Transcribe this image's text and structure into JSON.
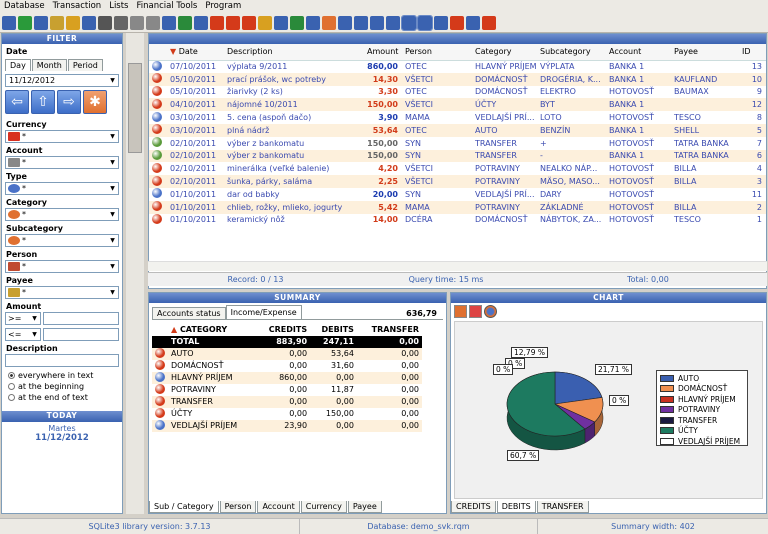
{
  "menu": [
    "Database",
    "Transaction",
    "Lists",
    "Financial Tools",
    "Program"
  ],
  "toolbar_icons": [
    "db-icon",
    "refresh-icon",
    "db2-icon",
    "lock-icon",
    "folder-icon",
    "save-icon",
    "eye-icon",
    "comments-icon",
    "calc-icon",
    "grid-icon",
    "doc-icon",
    "excel-icon",
    "xml-icon",
    "graph-icon",
    "gem-icon",
    "cart-icon",
    "pencil-icon",
    "users-icon",
    "tree-icon",
    "bank-icon",
    "tag-icon",
    "table-icon",
    "cal-icon",
    "list-icon",
    "screen-icon",
    "view1-icon",
    "view2-icon",
    "help-icon",
    "globe-icon",
    "info-icon",
    "power-icon"
  ],
  "filter": {
    "title": "FILTER",
    "date_label": "Date",
    "tabs": [
      "Day",
      "Month",
      "Period"
    ],
    "date_value": "11/12/2012",
    "currency_label": "Currency",
    "currency_value": "*",
    "account_label": "Account",
    "account_value": "*",
    "type_label": "Type",
    "type_value": "*",
    "category_label": "Category",
    "category_value": "*",
    "subcategory_label": "Subcategory",
    "subcategory_value": "*",
    "person_label": "Person",
    "person_value": "*",
    "payee_label": "Payee",
    "payee_value": "*",
    "amount_label": "Amount",
    "amount_op1": ">=",
    "amount_op2": "<=",
    "description_label": "Description",
    "radios": [
      "everywhere in text",
      "at the beginning",
      "at the end of text"
    ],
    "today_title": "TODAY",
    "today_day": "Martes",
    "today_date": "11/12/2012"
  },
  "grid": {
    "headers": [
      "Date",
      "Description",
      "Amount",
      "Person",
      "Category",
      "Subcategory",
      "Account",
      "Payee",
      "ID"
    ],
    "rows": [
      {
        "icon": "#4a72c8",
        "date": "07/10/2011",
        "desc": "výplata 9/2011",
        "amount": "860,00",
        "color": "blue",
        "person": "OTEC",
        "cat": "HLAVNÝ PRÍJEM",
        "sub": "VÝPLATA",
        "acc": "BANKA 1",
        "payee": "",
        "id": "13"
      },
      {
        "icon": "#d43a1a",
        "date": "05/10/2011",
        "desc": "prací prášok, wc potreby",
        "amount": "14,30",
        "color": "red",
        "person": "VŠETCI",
        "cat": "DOMÁCNOSŤ",
        "sub": "DROGÉRIA, K...",
        "acc": "BANKA 1",
        "payee": "KAUFLAND",
        "id": "10"
      },
      {
        "icon": "#d43a1a",
        "date": "05/10/2011",
        "desc": "žiarivky (2 ks)",
        "amount": "3,30",
        "color": "red",
        "person": "OTEC",
        "cat": "DOMÁCNOSŤ",
        "sub": "ELEKTRO",
        "acc": "HOTOVOSŤ",
        "payee": "BAUMAX",
        "id": "9"
      },
      {
        "icon": "#d43a1a",
        "date": "04/10/2011",
        "desc": "nájomné 10/2011",
        "amount": "150,00",
        "color": "red",
        "person": "VŠETCI",
        "cat": "ÚČTY",
        "sub": "BYT",
        "acc": "BANKA 1",
        "payee": "",
        "id": "12"
      },
      {
        "icon": "#4a72c8",
        "date": "03/10/2011",
        "desc": "5. cena (aspoň dačo)",
        "amount": "3,90",
        "color": "blue",
        "person": "MAMA",
        "cat": "VEDLAJŠÍ PRÍ...",
        "sub": "LOTO",
        "acc": "HOTOVOSŤ",
        "payee": "TESCO",
        "id": "8"
      },
      {
        "icon": "#d43a1a",
        "date": "03/10/2011",
        "desc": "plná nádrž",
        "amount": "53,64",
        "color": "red",
        "person": "OTEC",
        "cat": "AUTO",
        "sub": "BENZÍN",
        "acc": "BANKA 1",
        "payee": "SHELL",
        "id": "5"
      },
      {
        "icon": "#5a9a3a",
        "date": "02/10/2011",
        "desc": "výber z bankomatu",
        "amount": "150,00",
        "color": "gray",
        "person": "SYN",
        "cat": "TRANSFER",
        "sub": "+",
        "acc": "HOTOVOSŤ",
        "payee": "TATRA BANKA",
        "id": "7"
      },
      {
        "icon": "#5a9a3a",
        "date": "02/10/2011",
        "desc": "výber z bankomatu",
        "amount": "150,00",
        "color": "gray",
        "person": "SYN",
        "cat": "TRANSFER",
        "sub": "-",
        "acc": "BANKA 1",
        "payee": "TATRA BANKA",
        "id": "6"
      },
      {
        "icon": "#d43a1a",
        "date": "02/10/2011",
        "desc": "minerálka (veľké balenie)",
        "amount": "4,20",
        "color": "red",
        "person": "VŠETCI",
        "cat": "POTRAVINY",
        "sub": "NEALKO NÁP...",
        "acc": "HOTOVOSŤ",
        "payee": "BILLA",
        "id": "4"
      },
      {
        "icon": "#d43a1a",
        "date": "02/10/2011",
        "desc": "šunka, párky, saláma",
        "amount": "2,25",
        "color": "red",
        "person": "VŠETCI",
        "cat": "POTRAVINY",
        "sub": "MÄSO, MASO...",
        "acc": "HOTOVOSŤ",
        "payee": "BILLA",
        "id": "3"
      },
      {
        "icon": "#4a72c8",
        "date": "01/10/2011",
        "desc": "dar od babky",
        "amount": "20,00",
        "color": "blue",
        "person": "SYN",
        "cat": "VEDLAJŠÍ PRÍ...",
        "sub": "DARY",
        "acc": "HOTOVOSŤ",
        "payee": "",
        "id": "11"
      },
      {
        "icon": "#d43a1a",
        "date": "01/10/2011",
        "desc": "chlieb, rožky, mlieko, jogurty",
        "amount": "5,42",
        "color": "red",
        "person": "MAMA",
        "cat": "POTRAVINY",
        "sub": "ZÁKLADNÉ",
        "acc": "HOTOVOSŤ",
        "payee": "BILLA",
        "id": "2"
      },
      {
        "icon": "#d43a1a",
        "date": "01/10/2011",
        "desc": "keramický nôž",
        "amount": "14,00",
        "color": "red",
        "person": "DCÉRA",
        "cat": "DOMÁCNOSŤ",
        "sub": "NÁBYTOK, ZA...",
        "acc": "HOTOVOSŤ",
        "payee": "TESCO",
        "id": "1"
      }
    ],
    "status_record": "Record: 0 / 13",
    "status_query": "Query time: 15 ms",
    "status_total": "Total: 0,00"
  },
  "summary": {
    "title": "SUMMARY",
    "tabs": [
      "Accounts status",
      "Income/Expense"
    ],
    "value": "636,79",
    "headers": [
      "CATEGORY",
      "CREDITS",
      "DEBITS",
      "TRANSFER"
    ],
    "total": {
      "cat": "TOTAL",
      "credits": "883,90",
      "debits": "247,11",
      "transfer": "0,00"
    },
    "rows": [
      {
        "cat": "AUTO",
        "credits": "0,00",
        "debits": "53,64",
        "transfer": "0,00"
      },
      {
        "cat": "DOMÁCNOSŤ",
        "credits": "0,00",
        "debits": "31,60",
        "transfer": "0,00"
      },
      {
        "cat": "HLAVNÝ PRÍJEM",
        "credits": "860,00",
        "debits": "0,00",
        "transfer": "0,00"
      },
      {
        "cat": "POTRAVINY",
        "credits": "0,00",
        "debits": "11,87",
        "transfer": "0,00"
      },
      {
        "cat": "TRANSFER",
        "credits": "0,00",
        "debits": "0,00",
        "transfer": "0,00"
      },
      {
        "cat": "ÚČTY",
        "credits": "0,00",
        "debits": "150,00",
        "transfer": "0,00"
      },
      {
        "cat": "VEDLAJŠÍ PRÍJEM",
        "credits": "23,90",
        "debits": "0,00",
        "transfer": "0,00"
      }
    ],
    "bottom_tabs": [
      "Sub / Category",
      "Person",
      "Account",
      "Currency",
      "Payee"
    ]
  },
  "chart": {
    "title": "CHART",
    "bottom_tabs": [
      "CREDITS",
      "DEBITS",
      "TRANSFER"
    ],
    "legend": [
      {
        "name": "AUTO",
        "color": "#3a5fb0"
      },
      {
        "name": "DOMÁCNOSŤ",
        "color": "#f09050"
      },
      {
        "name": "HLAVNÝ PRÍJEM",
        "color": "#c83020"
      },
      {
        "name": "POTRAVINY",
        "color": "#7030a0"
      },
      {
        "name": "TRANSFER",
        "color": "#1a1a40"
      },
      {
        "name": "ÚČTY",
        "color": "#1d7a60"
      },
      {
        "name": "VEDLAJŠÍ PRÍJEM",
        "color": "#ffffff"
      }
    ],
    "labels": [
      "12,79 %",
      "0 %",
      "0 %",
      "21,71 %",
      "0 %",
      "60,7 %"
    ]
  },
  "chart_data": {
    "type": "pie",
    "categories": [
      "AUTO",
      "DOMÁCNOSŤ",
      "HLAVNÝ PRÍJEM",
      "POTRAVINY",
      "TRANSFER",
      "ÚČTY",
      "VEDLAJŠÍ PRÍJEM"
    ],
    "values": [
      21.71,
      12.79,
      0,
      4.8,
      0,
      60.7,
      0
    ]
  },
  "statusbar": {
    "left": "SQLite3 library version: 3.7.13",
    "mid": "Database: demo_svk.rqm",
    "right": "Summary width: 402"
  }
}
